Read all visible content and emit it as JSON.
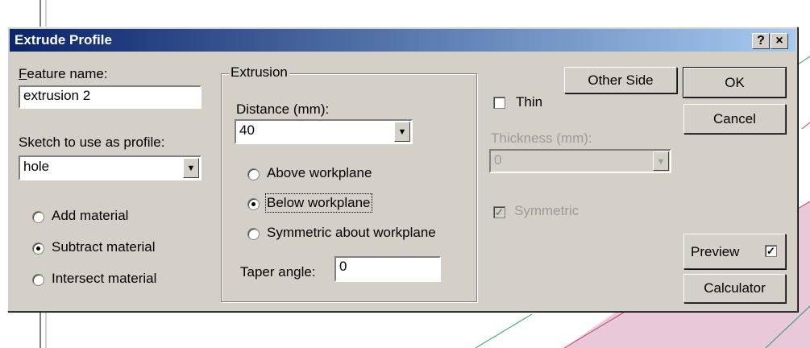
{
  "dialog": {
    "title": "Extrude Profile",
    "help_button": "?",
    "close_button": "×"
  },
  "feature_name": {
    "label": "Feature name:",
    "value": "extrusion 2"
  },
  "sketch": {
    "label": "Sketch to use as profile:",
    "value": "hole"
  },
  "material_options": [
    {
      "label": "Add material",
      "selected": false
    },
    {
      "label": "Subtract material",
      "selected": true
    },
    {
      "label": "Intersect material",
      "selected": false
    }
  ],
  "extrusion": {
    "group_title": "Extrusion",
    "distance_label": "Distance (mm):",
    "distance_value": "40",
    "direction_options": [
      {
        "label": "Above workplane",
        "selected": false
      },
      {
        "label": "Below workplane",
        "selected": true
      },
      {
        "label": "Symmetric about workplane",
        "selected": false
      }
    ],
    "taper_label": "Taper angle:",
    "taper_value": "0"
  },
  "other_side_button": "Other Side",
  "thin": {
    "label": "Thin",
    "checked": false,
    "thickness_label": "Thickness (mm):",
    "thickness_value": "0",
    "symmetric_label": "Symmetric",
    "symmetric_checked": true
  },
  "buttons": {
    "ok": "OK",
    "cancel": "Cancel",
    "preview": "Preview",
    "preview_checked": true,
    "calculator": "Calculator"
  },
  "colors": {
    "title_bar_start": "#0a246a",
    "title_bar_end": "#a6caf0",
    "dialog_face": "#d4d0c8",
    "background_pink": "#e9c9d9"
  }
}
